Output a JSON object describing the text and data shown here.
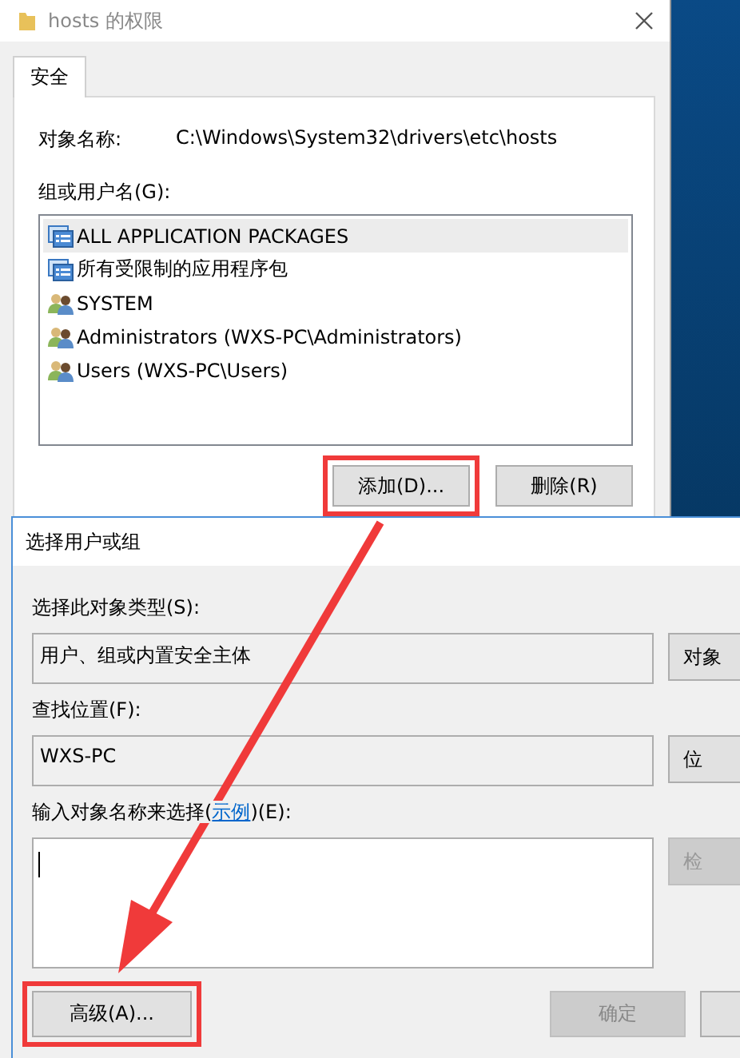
{
  "window": {
    "title": "hosts 的权限",
    "tabs": [
      {
        "label": "安全",
        "selected": true
      }
    ],
    "object_name": {
      "label": "对象名称:",
      "value": "C:\\Windows\\System32\\drivers\\etc\\hosts"
    },
    "users": {
      "label": "组或用户名(G):",
      "items": [
        {
          "name": "ALL APPLICATION PACKAGES",
          "kind": "package",
          "selected": true
        },
        {
          "name": "所有受限制的应用程序包",
          "kind": "package",
          "selected": false
        },
        {
          "name": "SYSTEM",
          "kind": "users",
          "selected": false
        },
        {
          "name": "Administrators (WXS-PC\\Administrators)",
          "kind": "users",
          "selected": false
        },
        {
          "name": "Users (WXS-PC\\Users)",
          "kind": "users",
          "selected": false
        }
      ]
    },
    "buttons": [
      {
        "label": "添加(D)...",
        "highlighted": true
      },
      {
        "label": "删除(R)",
        "highlighted": false
      }
    ]
  },
  "dialog": {
    "title": "选择用户或组",
    "object_types": {
      "label": "选择此对象类型(S):",
      "value": "用户、组或内置安全主体",
      "button": "对象"
    },
    "location": {
      "label": "查找位置(F):",
      "value": "WXS-PC",
      "button": "位"
    },
    "names": {
      "label_before": "输入对象名称来选择(",
      "link": "示例",
      "label_after": ")(E):",
      "button": "检"
    },
    "advanced": {
      "label": "高级(A)...",
      "highlighted": true
    },
    "ok": {
      "label": "确定",
      "disabled": true
    }
  }
}
